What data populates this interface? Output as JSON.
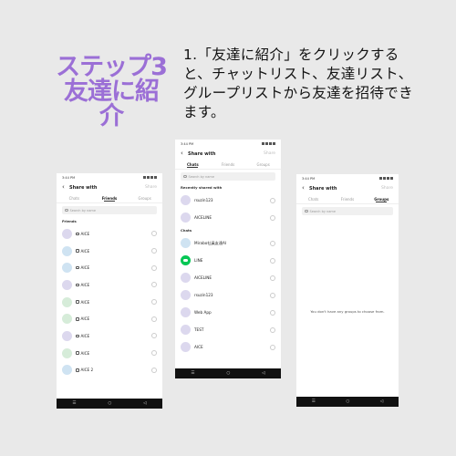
{
  "step": {
    "title_line1": "ステップ3",
    "title_line2": "友達に紹",
    "title_line3": "介",
    "description": "1.「友達に紹介」をクリックすると、チャットリスト、友達リスト、グループリストから友達を招待できます。"
  },
  "phone_friends": {
    "status_time": "3:44 PM",
    "header": {
      "back_icon": "back-arrow-icon",
      "title": "Share with",
      "share_label": "Share"
    },
    "tabs": [
      "Chats",
      "Friends",
      "Groups"
    ],
    "active_tab": "Friends",
    "search_placeholder": "Search by name",
    "section_title": "Friends",
    "friends": [
      {
        "name": "AICE",
        "color": "purple"
      },
      {
        "name": "AICE",
        "color": "blue"
      },
      {
        "name": "AICE",
        "color": "blue"
      },
      {
        "name": "AICE",
        "color": "purple"
      },
      {
        "name": "AICE",
        "color": "green"
      },
      {
        "name": "AICE",
        "color": "green"
      },
      {
        "name": "AICE",
        "color": "purple"
      },
      {
        "name": "AICE",
        "color": "green"
      },
      {
        "name": "AICE 2",
        "color": "blue"
      }
    ],
    "nav": [
      "☰",
      "○",
      "◁"
    ]
  },
  "phone_chats": {
    "status_time": "3:44 PM",
    "header": {
      "back_icon": "back-arrow-icon",
      "title": "Share with",
      "share_label": "Share"
    },
    "tabs": [
      "Chats",
      "Friends",
      "Groups"
    ],
    "active_tab": "Chats",
    "search_placeholder": "Search by name",
    "recent_title": "Recently shared with",
    "recent": [
      {
        "name": "rsuzin123",
        "color": "purple"
      },
      {
        "name": "AICELINE",
        "color": "purple"
      }
    ],
    "chats_title": "Chats",
    "chats": [
      {
        "name": "Mirabo社員友達AI",
        "color": "blue"
      },
      {
        "name": "LINE",
        "color": "line"
      },
      {
        "name": "AICELINE",
        "color": "purple"
      },
      {
        "name": "rsuzin123",
        "color": "purple"
      },
      {
        "name": "Web App",
        "color": "purple"
      },
      {
        "name": "TEST",
        "color": "purple"
      },
      {
        "name": "AICE",
        "color": "purple"
      }
    ],
    "nav": [
      "☰",
      "○",
      "◁"
    ]
  },
  "phone_groups": {
    "status_time": "3:44 PM",
    "header": {
      "back_icon": "back-arrow-icon",
      "title": "Share with",
      "share_label": "Share"
    },
    "tabs": [
      "Chats",
      "Friends",
      "Groups"
    ],
    "active_tab": "Groups",
    "search_placeholder": "Search by name",
    "empty_message": "You don't have any groups to choose from.",
    "nav": [
      "☰",
      "○",
      "◁"
    ]
  }
}
